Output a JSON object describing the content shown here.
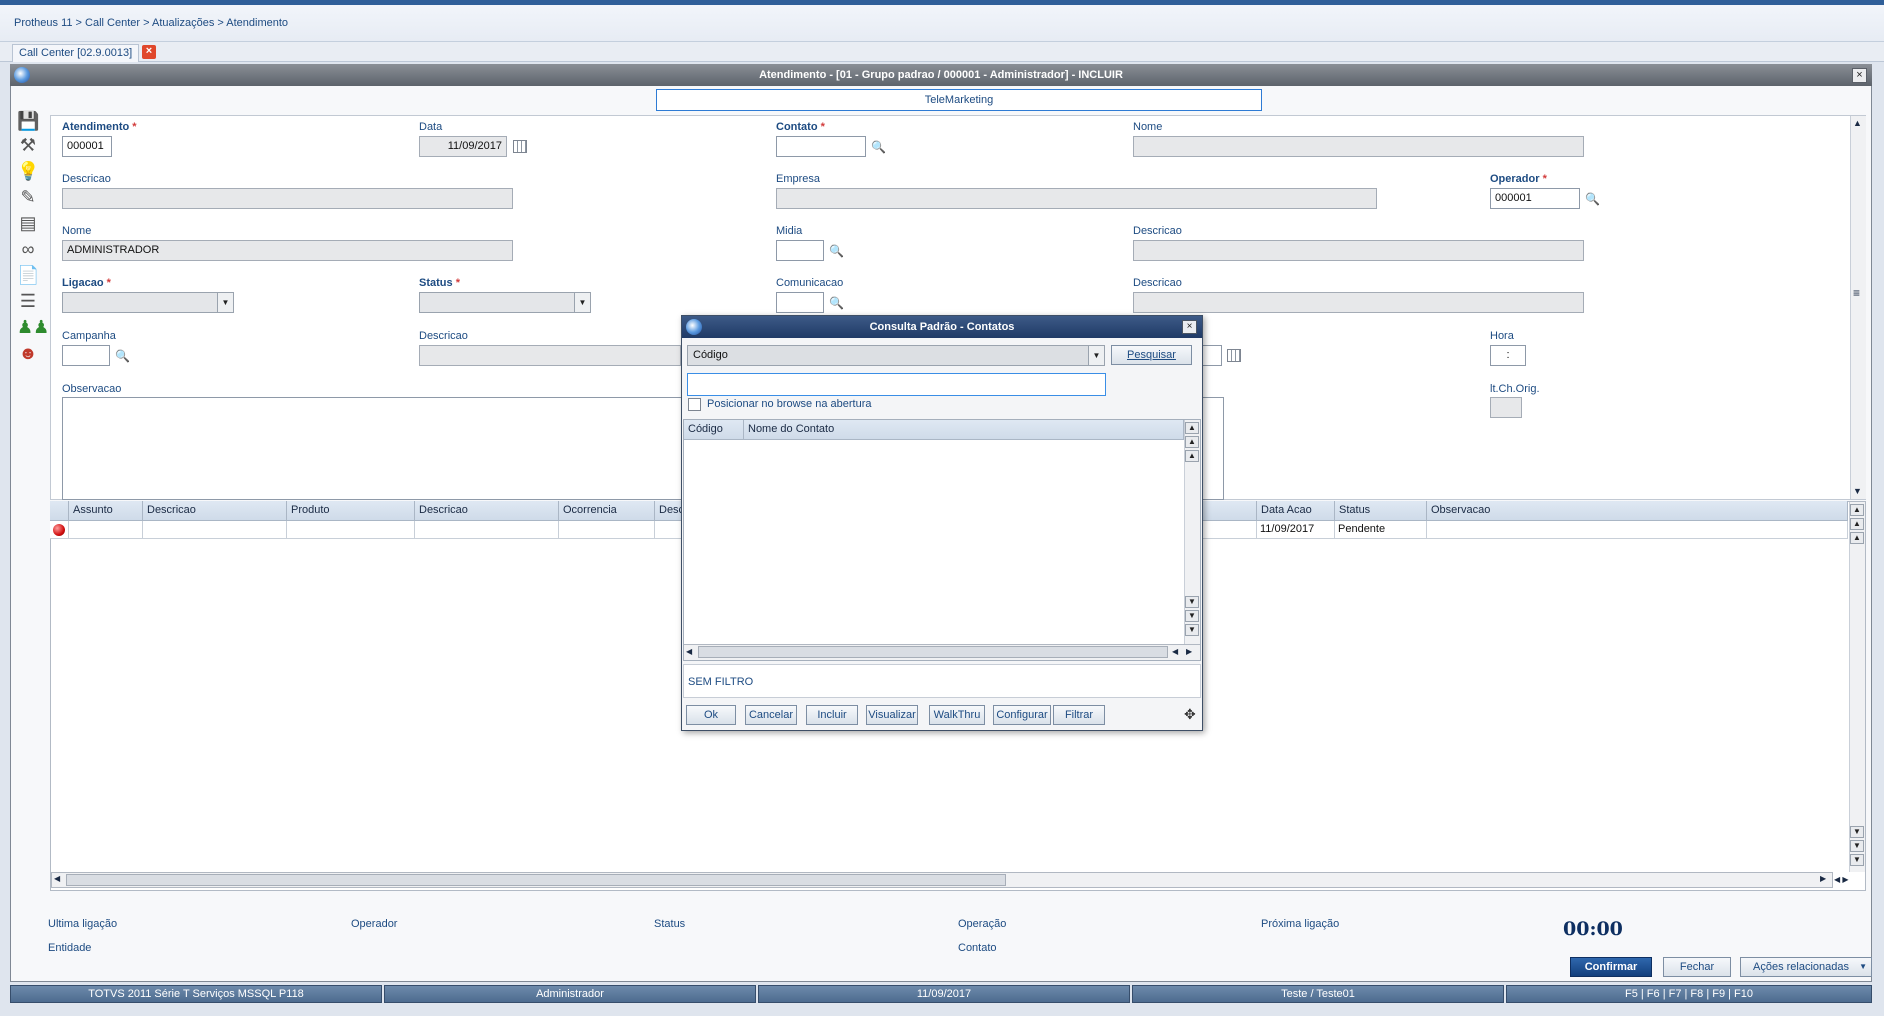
{
  "app": {
    "breadcrumb": "Protheus 11 > Call Center > Atualizações > Atendimento",
    "tab_label": "Call Center [02.9.0013]",
    "tab_close": "×"
  },
  "window": {
    "title": "Atendimento - [01 - Grupo padrao / 000001 - Administrador] - INCLUIR",
    "close": "×",
    "section_tab": "TeleMarketing"
  },
  "form": {
    "atendimento": {
      "label": "Atendimento",
      "value": "000001"
    },
    "data": {
      "label": "Data",
      "value": "11/09/2017"
    },
    "contato": {
      "label": "Contato",
      "value": ""
    },
    "nome_contato": {
      "label": "Nome",
      "value": ""
    },
    "descricao1": {
      "label": "Descricao",
      "value": ""
    },
    "empresa": {
      "label": "Empresa",
      "value": ""
    },
    "operador": {
      "label": "Operador",
      "value": "000001"
    },
    "nome_operador": {
      "label": "Nome",
      "value": "ADMINISTRADOR"
    },
    "midia": {
      "label": "Midia",
      "value": ""
    },
    "descricao_midia": {
      "label": "Descricao",
      "value": ""
    },
    "ligacao": {
      "label": "Ligacao",
      "value": ""
    },
    "status": {
      "label": "Status",
      "value": ""
    },
    "comunicacao": {
      "label": "Comunicacao",
      "value": ""
    },
    "descricao_com": {
      "label": "Descricao",
      "value": ""
    },
    "campanha": {
      "label": "Campanha",
      "value": ""
    },
    "descricao_camp": {
      "label": "Descricao",
      "value": ""
    },
    "hora": {
      "label": "Hora",
      "value": ":"
    },
    "observacao": {
      "label": "Observacao",
      "value": ""
    },
    "lt_ch_orig": {
      "label": "lt.Ch.Orig.",
      "value": ""
    },
    "required_mark": "*"
  },
  "grid": {
    "columns": [
      "Assunto",
      "Descricao",
      "Produto",
      "Descricao",
      "Ocorrencia",
      "Desc",
      "Data Acao",
      "Status",
      "Observacao"
    ],
    "row": {
      "data_acao": "11/09/2017",
      "status": "Pendente"
    }
  },
  "footer": {
    "ultima_ligacao": "Ultima ligação",
    "operador": "Operador",
    "status": "Status",
    "operacao": "Operação",
    "proxima_ligacao": "Próxima ligação",
    "entidade": "Entidade",
    "contato": "Contato",
    "timer": "00:00"
  },
  "buttons": {
    "confirmar": "Confirmar",
    "fechar": "Fechar",
    "acoes": "Ações relacionadas"
  },
  "statusbar": [
    "TOTVS 2011 Série T Serviços MSSQL P118",
    "Administrador",
    "11/09/2017",
    "Teste / Teste01",
    "F5 | F6 | F7 | F8 | F9 | F10"
  ],
  "dialog": {
    "title": "Consulta Padrão - Contatos",
    "close": "×",
    "search_by": "Código",
    "search_button": "Pesquisar",
    "search_value": "",
    "checkbox_label": "Posicionar no browse na abertura",
    "columns": [
      "Código",
      "Nome do Contato"
    ],
    "filter_text": "SEM FILTRO",
    "buttons": [
      "Ok",
      "Cancelar",
      "Incluir",
      "Visualizar",
      "WalkThru",
      "Configurar",
      "Filtrar"
    ]
  },
  "colors": {
    "accent": "#1d4b82",
    "title_bar": "#5d636b",
    "dialog_title": "#1f3a66",
    "primary_button": "#123f7d",
    "status_bar": "#4d6b8f",
    "required": "#d23b3b"
  }
}
